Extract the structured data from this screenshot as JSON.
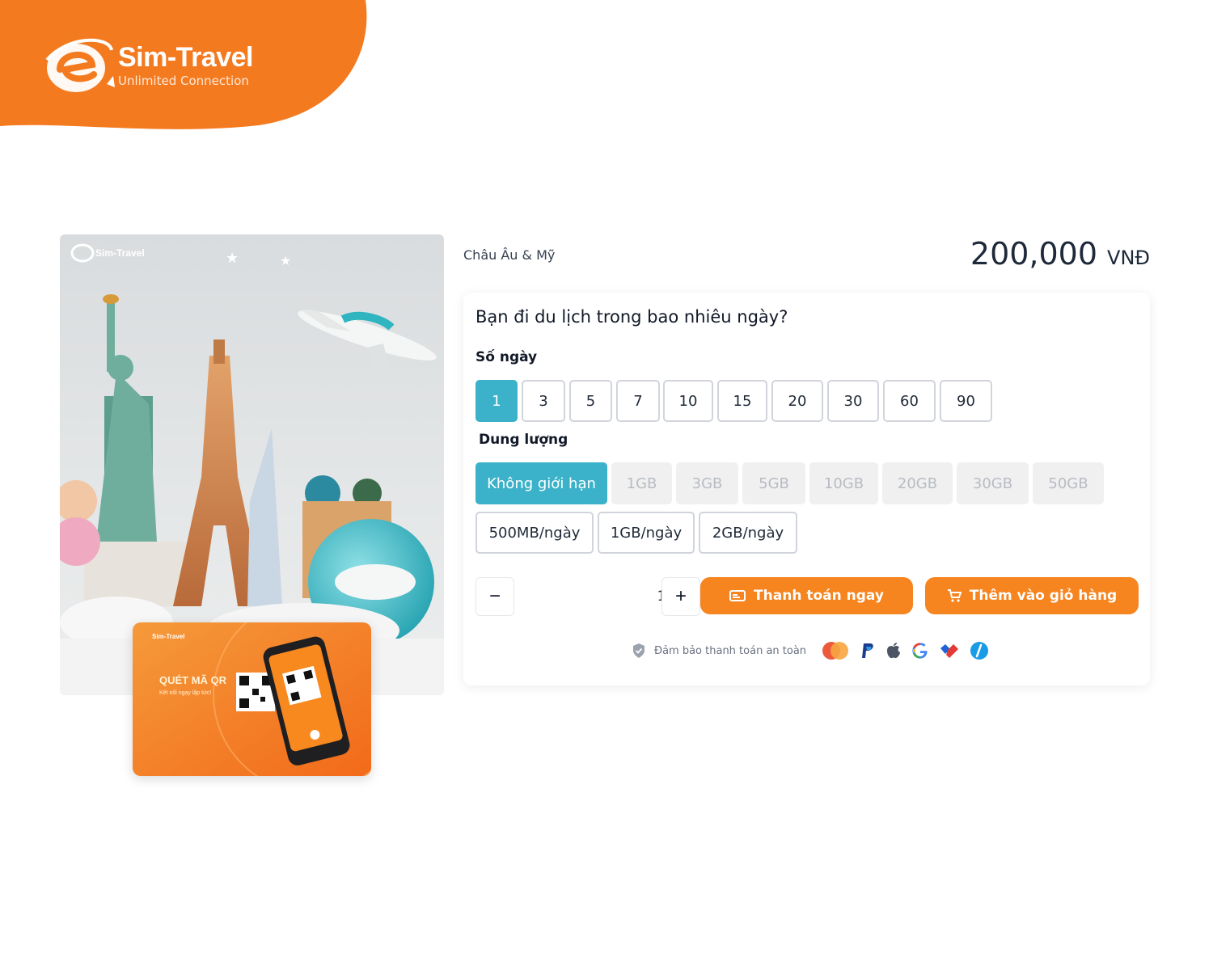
{
  "brand": {
    "name": "Sim-Travel",
    "tagline": "Unlimited Connection",
    "color": "#f47a20"
  },
  "product": {
    "region": "Châu Âu & Mỹ",
    "price": "200,000",
    "currency": "VNĐ",
    "image_logo": "Sim-Travel",
    "qr_card_title": "QUÉT MÃ QR",
    "qr_card_sub": "Kết nối ngay lập tức!",
    "qr_card_logo": "Sim-Travel"
  },
  "form": {
    "question": "Bạn đi du lịch trong bao nhiêu ngày?",
    "days_label": "Số ngày",
    "days": [
      "1",
      "3",
      "5",
      "7",
      "10",
      "15",
      "20",
      "30",
      "60",
      "90"
    ],
    "days_selected": "1",
    "data_label": "Dung lượng",
    "data_options": [
      "Không giới hạn",
      "1GB",
      "3GB",
      "5GB",
      "10GB",
      "20GB",
      "30GB",
      "50GB"
    ],
    "data_selected": "Không giới hạn",
    "daily_options": [
      "500MB/ngày",
      "1GB/ngày",
      "2GB/ngày"
    ]
  },
  "cart": {
    "quantity": "1",
    "minus": "−",
    "plus": "+",
    "buy_now": "Thanh toán ngay",
    "add_to_cart": "Thêm vào giỏ hàng"
  },
  "secure": {
    "text": "Đảm bảo thanh toán an toàn",
    "methods": [
      "mastercard-icon",
      "paypal-icon",
      "apple-icon",
      "google-icon",
      "ecommerce-icon",
      "wallet-icon"
    ]
  },
  "colors": {
    "accent": "#3bb2c9",
    "cta": "#f6841f"
  }
}
